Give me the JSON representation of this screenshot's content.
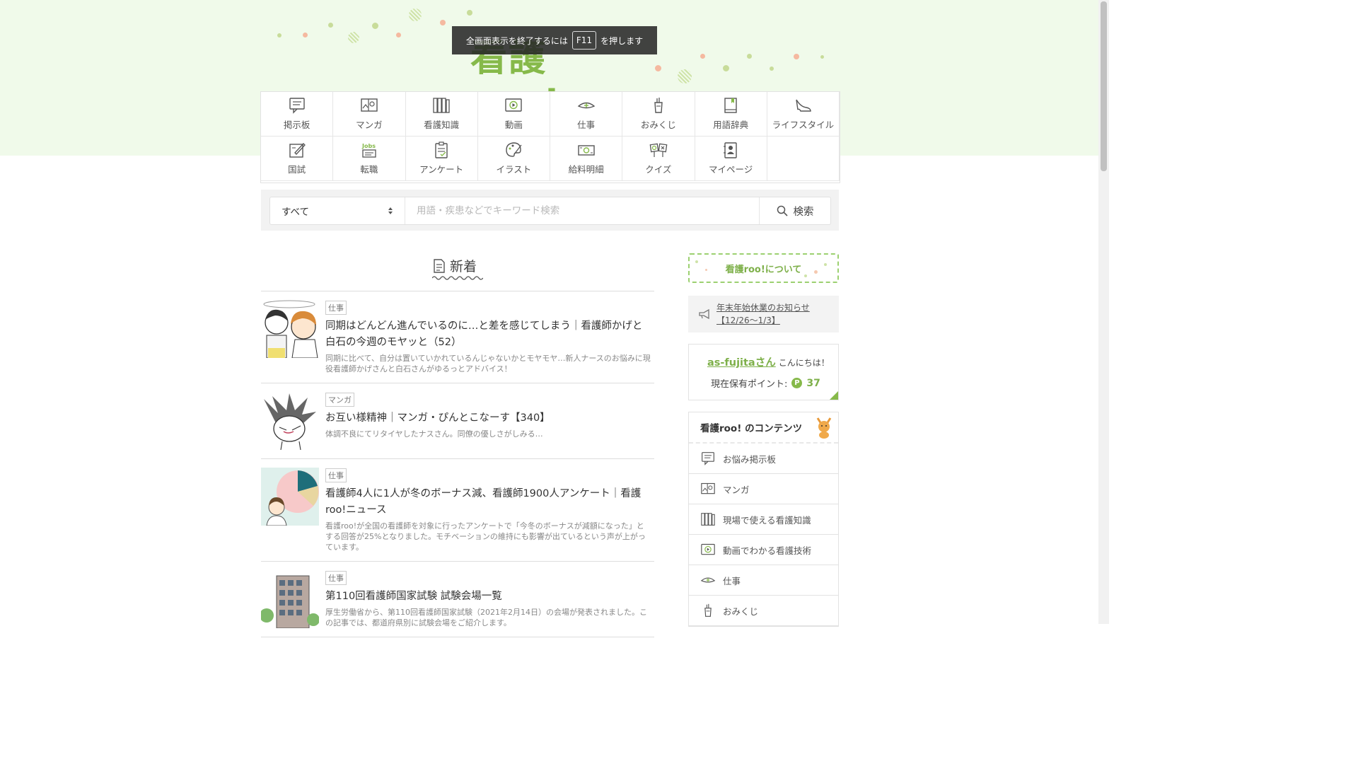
{
  "fullscreen_toast": {
    "before": "全画面表示を終了するには",
    "key": "F11",
    "after": "を押します"
  },
  "logo": {
    "text": "看護roo!"
  },
  "colors": {
    "brand_green": "#86b94a",
    "hero_bg": "#f0faea",
    "link_green": "#7eb04a"
  },
  "nav": {
    "items": [
      {
        "label": "掲示板",
        "icon": "bulletin-board-icon"
      },
      {
        "label": "マンガ",
        "icon": "manga-icon"
      },
      {
        "label": "看護知識",
        "icon": "books-icon"
      },
      {
        "label": "動画",
        "icon": "video-icon"
      },
      {
        "label": "仕事",
        "icon": "nurse-cap-icon"
      },
      {
        "label": "おみくじ",
        "icon": "omikuji-icon"
      },
      {
        "label": "用語辞典",
        "icon": "dictionary-icon"
      },
      {
        "label": "ライフスタイル",
        "icon": "high-heel-icon"
      },
      {
        "label": "国試",
        "icon": "exam-icon"
      },
      {
        "label": "転職",
        "icon": "jobs-icon"
      },
      {
        "label": "アンケート",
        "icon": "survey-icon"
      },
      {
        "label": "イラスト",
        "icon": "palette-icon"
      },
      {
        "label": "給料明細",
        "icon": "money-icon"
      },
      {
        "label": "クイズ",
        "icon": "quiz-icon"
      },
      {
        "label": "マイページ",
        "icon": "mypage-icon"
      }
    ]
  },
  "search": {
    "category": "すべて",
    "placeholder": "用語・疾患などでキーワード検索",
    "button": "検索"
  },
  "section": {
    "title": "新着"
  },
  "articles": [
    {
      "tag": "仕事",
      "title": "同期はどんどん進んでいるのに…と差を感じてしまう｜看護師かげと白石の今週のモヤッと（52）",
      "desc": "同期に比べて、自分は置いていかれているんじゃないかとモヤモヤ…新人ナースのお悩みに現役看護師かげさんと白石さんがゆるっとアドバイス！"
    },
    {
      "tag": "マンガ",
      "title": "お互い様精神｜マンガ・ぴんとこなーす【340】",
      "desc": "体調不良にてリタイヤしたナスさん。同僚の優しさがしみる…"
    },
    {
      "tag": "仕事",
      "title": "看護師4人に1人が冬のボーナス減、看護師1900人アンケート｜看護roo!ニュース",
      "desc": "看護roo!が全国の看護師を対象に行ったアンケートで「今冬のボーナスが減額になった」とする回答が25%となりました。モチベーションの維持にも影響が出ているという声が上がっています。"
    },
    {
      "tag": "仕事",
      "title": "第110回看護師国家試験 試験会場一覧",
      "desc": "厚生労働省から、第110回看護師国家試験（2021年2月14日）の会場が発表されました。この記事では、都道府県別に試験会場をご紹介します。"
    }
  ],
  "sidebar": {
    "about": "看護roo!について",
    "notice": {
      "line1": "年末年始休業のお知らせ",
      "line2": "【12/26～1/3】"
    },
    "user": {
      "name": "as-fujitaさん",
      "greeting": "こんにちは！",
      "points_label": "現在保有ポイント:",
      "points_badge": "P",
      "points": "37"
    },
    "contents": {
      "title": "看護roo! のコンテンツ",
      "items": [
        {
          "label": "お悩み掲示板"
        },
        {
          "label": "マンガ"
        },
        {
          "label": "現場で使える看護知識"
        },
        {
          "label": "動画でわかる看護技術"
        },
        {
          "label": "仕事"
        },
        {
          "label": "おみくじ"
        }
      ]
    }
  }
}
